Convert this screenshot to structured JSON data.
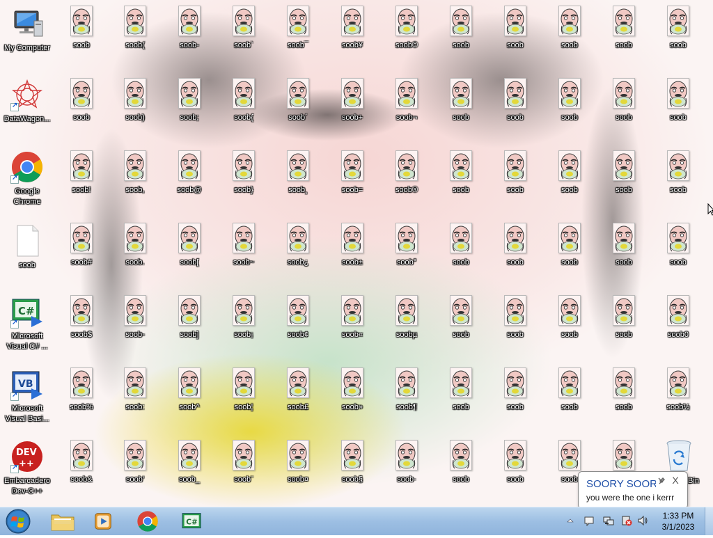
{
  "desktop": {
    "left_icons": [
      {
        "label": "My Computer",
        "icon": "computer-icon",
        "shortcut": false
      },
      {
        "label": "DataWagon...",
        "icon": "datawagon-icon",
        "shortcut": true
      },
      {
        "label": "Google Chrome",
        "icon": "chrome-icon",
        "shortcut": true
      },
      {
        "label": "soob",
        "icon": "blank-file-icon",
        "shortcut": false
      },
      {
        "label": "Microsoft Visual C# ...",
        "icon": "visual-csharp-icon",
        "shortcut": true
      },
      {
        "label": "Microsoft Visual Basi...",
        "icon": "visual-basic-icon",
        "shortcut": true
      },
      {
        "label": "Embarcadero Dev-C++",
        "icon": "devcpp-icon",
        "shortcut": true
      }
    ],
    "soob_icon": "soob-face-file-icon",
    "soob_grid": [
      [
        "soob",
        "soob(",
        "soob-",
        "soob`",
        "soob¯",
        "soob¥",
        "soob©",
        "soob",
        "soob",
        "soob",
        "soob",
        "soob"
      ],
      [
        "soob",
        "soob)",
        "soob;",
        "soob{",
        "soob´",
        "soob+",
        "soob¬",
        "soob",
        "soob",
        "soob",
        "soob",
        "soob"
      ],
      [
        "soob!",
        "soob,",
        "soob@",
        "soob}",
        "soob¸",
        "soob=",
        "soob®",
        "soob",
        "soob",
        "soob",
        "soob",
        "soob"
      ],
      [
        "soob#",
        "soob.",
        "soob[",
        "soob~",
        "soob¿",
        "soob±",
        "soob°",
        "soob",
        "soob",
        "soob",
        "soob",
        "soob"
      ],
      [
        "soob$",
        "soob-",
        "soob]",
        "soob¡",
        "soob¢",
        "soob«",
        "soobµ",
        "soob",
        "soob",
        "soob",
        "soob",
        "soob0"
      ],
      [
        "soob%",
        "soob:",
        "soob^",
        "soob¦",
        "soob£",
        "soob»",
        "soob¶",
        "soob",
        "soob",
        "soob",
        "soob",
        "soob½"
      ],
      [
        "soob&",
        "soob'",
        "soob_",
        "soob¨",
        "soob¤",
        "soob§",
        "soob·",
        "soob",
        "soob",
        "soob",
        "soob",
        ""
      ]
    ],
    "recycle_bin": {
      "label": "Recycle Bin",
      "visible_label": "Bin",
      "icon": "recycle-bin-icon"
    }
  },
  "balloon": {
    "title": "SOORY SOOR",
    "text": "you were the one i kerrr",
    "options_icon": "pin-icon",
    "close_label": "X"
  },
  "taskbar": {
    "start_icon": "windows-start-icon",
    "pinned": [
      {
        "name": "explorer",
        "icon": "folder-icon"
      },
      {
        "name": "media-player",
        "icon": "media-player-icon"
      },
      {
        "name": "chrome",
        "icon": "chrome-icon"
      },
      {
        "name": "visual-csharp",
        "icon": "visual-csharp-icon"
      }
    ],
    "tray": [
      {
        "icon": "show-hidden-icons-arrow-icon"
      },
      {
        "icon": "action-center-icon"
      },
      {
        "icon": "network-icon"
      },
      {
        "icon": "no-sound-device-icon"
      },
      {
        "icon": "volume-icon"
      }
    ],
    "clock": {
      "time": "1:33 PM",
      "date": "3/1/2023"
    }
  },
  "colors": {
    "taskbar": "#9dbfe3",
    "balloon_title": "#1f4fa8",
    "wallpaper_pink": "#f6d6d4",
    "wallpaper_green": "#c4e2c8",
    "wallpaper_yellow": "#e8d628"
  }
}
